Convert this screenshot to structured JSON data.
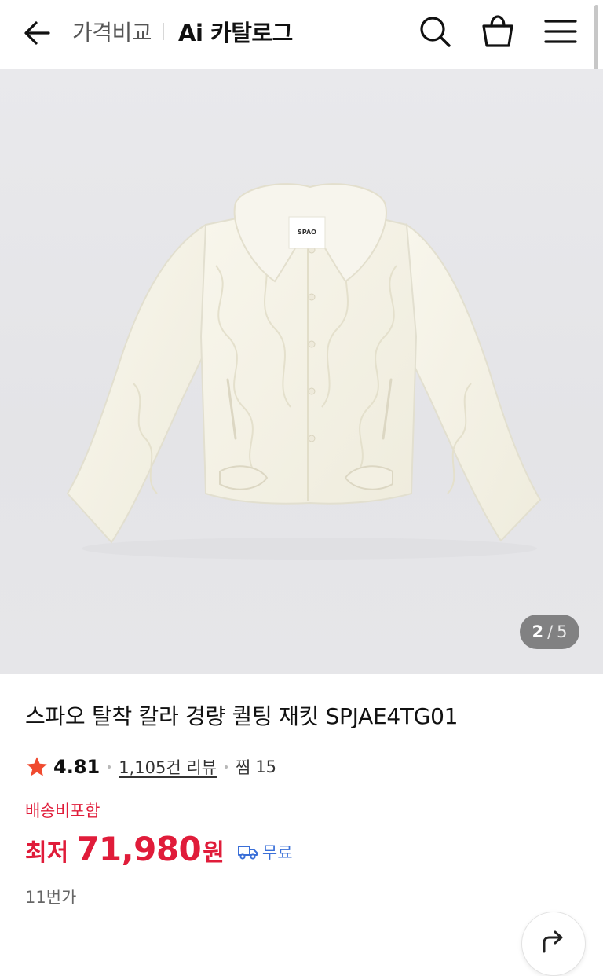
{
  "header": {
    "back_icon": "arrow-left-icon",
    "breadcrumb_price_compare": "가격비교",
    "breadcrumb_catalog": "Ai 카탈로그",
    "search_icon": "search-icon",
    "cart_icon": "shopping-bag-icon",
    "menu_icon": "hamburger-menu-icon"
  },
  "gallery": {
    "current": "2",
    "separator": "/",
    "total": "5",
    "tag_text": "SPAO"
  },
  "product": {
    "title": "스파오 탈착 칼라 경량 퀼팅 재킷 SPJAE4TG01",
    "rating": "4.81",
    "review_count": "1,105건 리뷰",
    "zzim_label": "찜",
    "zzim_count": "15",
    "shipping_note": "배송비포함",
    "price_label": "최저",
    "price_value": "71,980",
    "price_unit": "원",
    "shipping_fee": "무료",
    "seller": "11번가"
  },
  "colors": {
    "accent_red": "#e01c3a",
    "star": "#f04a2f",
    "shipping_blue": "#3a6fd8"
  },
  "share_icon": "share-arrow-icon"
}
